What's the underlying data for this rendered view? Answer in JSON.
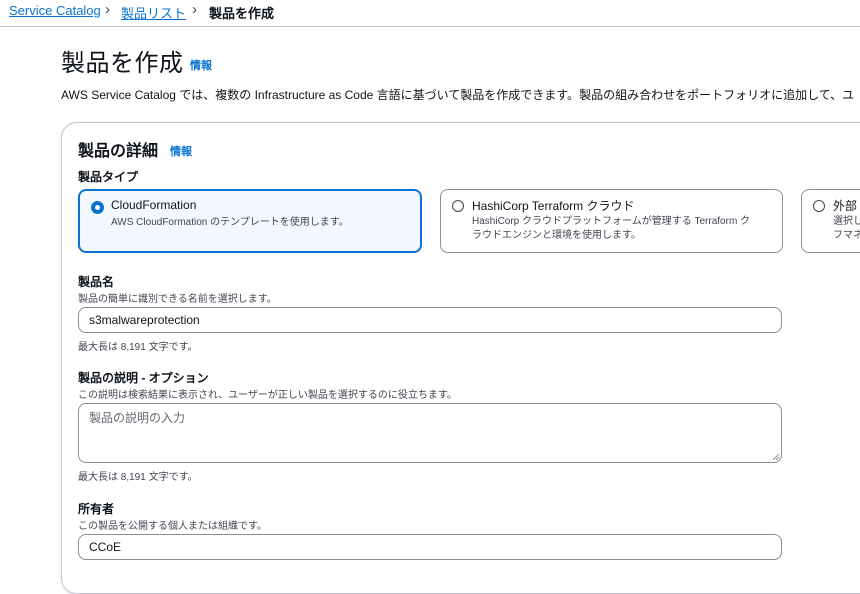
{
  "breadcrumb": {
    "items": [
      "Service Catalog",
      "製品リスト"
    ],
    "current": "製品を作成"
  },
  "header": {
    "title": "製品を作成",
    "info_label": "情報",
    "description": "AWS Service Catalog では、複数の Infrastructure as Code 言語に基づいて製品を作成できます。製品の組み合わせをポートフォリオに追加して、ユ"
  },
  "product_details": {
    "title": "製品の詳細",
    "info_label": "情報",
    "product_type": {
      "label": "製品タイプ",
      "selected": "CloudFormation",
      "options": [
        {
          "title": "CloudFormation",
          "desc_line1": "AWS CloudFormation のテンプレートを使用します。",
          "desc_line2": ""
        },
        {
          "title": "HashiCorp Terraform クラウド",
          "desc_line1": "HashiCorp クラウドプラットフォームが管理する Terraform ク",
          "desc_line2": "ラウドエンジンと環境を使用します。"
        },
        {
          "title": "外部",
          "desc_line1": "選択し",
          "desc_line2": "フマネ"
        }
      ]
    },
    "product_name": {
      "label": "製品名",
      "description": "製品の簡単に識別できる名前を選択します。",
      "value": "s3malwareprotection",
      "constraint": "最大長は 8,191 文字です。"
    },
    "product_description": {
      "label": "製品の説明 - オプション",
      "description": "この説明は検索結果に表示され、ユーザーが正しい製品を選択するのに役立ちます。",
      "placeholder": "製品の説明の入力",
      "constraint": "最大長は 8,191 文字です。"
    },
    "owner": {
      "label": "所有者",
      "description": "この製品を公開する個人または組織です。",
      "value": "CCoE"
    }
  },
  "colors": {
    "link": "#0972d3",
    "selected_tile_bg": "#f2f8fd",
    "border": "#8c8c94",
    "text": "#0f141a",
    "secondary_text": "#424650"
  },
  "icons": [
    "chevron-right-icon",
    "radio-checked-icon",
    "radio-unchecked-icon",
    "resize-grip-icon"
  ]
}
